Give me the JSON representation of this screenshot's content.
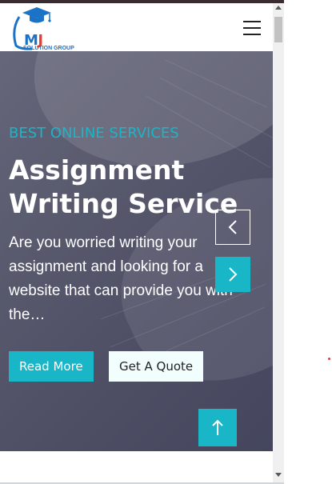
{
  "header": {
    "logo": {
      "brand_m": "M",
      "brand_j": "J",
      "subtitle": "SOLUTION GROUP",
      "brand_m_color": "#1a73c7",
      "brand_j_color": "#e8402f",
      "cap_color": "#1a73c7"
    },
    "menu_icon": "hamburger-menu-icon"
  },
  "hero": {
    "tagline": "BEST ONLINE SERVICES",
    "title": "Assignment Writing Service",
    "description": "Are you worried writing your assignment and looking for a website that can provide you with the…",
    "buttons": {
      "read_more": "Read More",
      "get_quote": "Get A Quote"
    },
    "prev_icon": "chevron-left-icon",
    "next_icon": "chevron-right-icon"
  },
  "back_to_top_icon": "arrow-up-icon",
  "colors": {
    "accent": "#19b6c8",
    "hero_text": "#ffffff",
    "quote_button_bg": "#f2fdfe"
  }
}
